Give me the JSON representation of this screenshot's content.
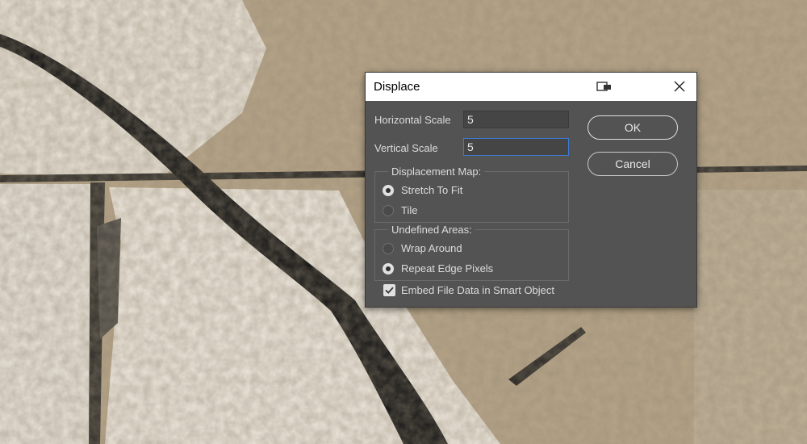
{
  "dialog": {
    "title": "Displace",
    "horizontal_scale": {
      "label": "Horizontal Scale",
      "value": "5"
    },
    "vertical_scale": {
      "label": "Vertical Scale",
      "value": "5"
    },
    "ok_label": "OK",
    "cancel_label": "Cancel",
    "displacement_map": {
      "legend": "Displacement Map:",
      "options": [
        "Stretch To Fit",
        "Tile"
      ],
      "selected": "Stretch To Fit"
    },
    "undefined_areas": {
      "legend": "Undefined Areas:",
      "options": [
        "Wrap Around",
        "Repeat Edge Pixels"
      ],
      "selected": "Repeat Edge Pixels"
    },
    "embed": {
      "label": "Embed File Data in Smart Object",
      "checked": true
    }
  },
  "icons": {
    "titlebar": "preview-window-icon",
    "close": "close-icon",
    "check": "checkmark-icon"
  },
  "colors": {
    "dialog_bg": "#535353",
    "focus_border": "#3d7bd6",
    "titlebar_bg": "#ffffff"
  }
}
